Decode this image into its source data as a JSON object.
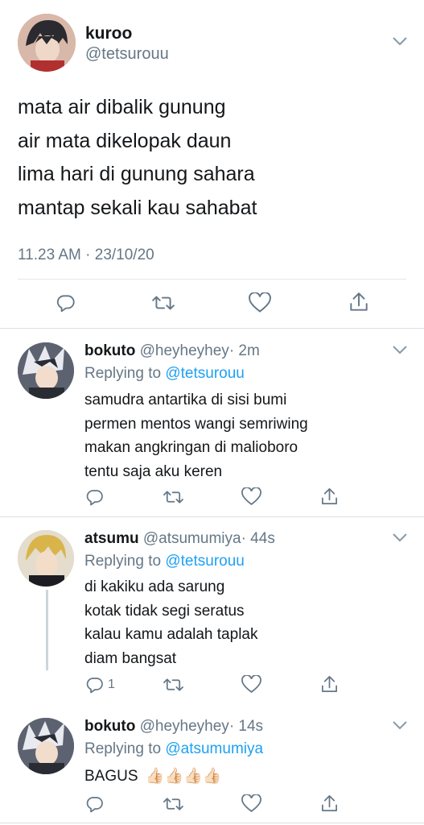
{
  "main_tweet": {
    "author_name": "kuroo",
    "author_handle": "@tetsurouu",
    "lines": [
      "mata air dibalik gunung",
      "air mata dikelopak daun",
      "lima hari di gunung sahara",
      "mantap sekali kau sahabat"
    ],
    "timestamp": "11.23 AM · 23/10/20"
  },
  "replies": [
    {
      "author_name": "bokuto",
      "author_handle": "@heyheyhey",
      "age": "· 2m",
      "replying_label": "Replying to",
      "replying_to": "@tetsurouu",
      "lines": [
        "samudra antartika di sisi bumi",
        "permen mentos wangi semriwing",
        "makan angkringan di malioboro",
        "tentu saja aku keren"
      ],
      "reply_count": ""
    },
    {
      "author_name": "atsumu",
      "author_handle": "@atsumumiya",
      "age": "· 44s",
      "replying_label": "Replying to",
      "replying_to": "@tetsurouu",
      "lines": [
        "di kakiku ada sarung",
        "kotak tidak segi seratus",
        "kalau kamu adalah taplak",
        "diam bangsat"
      ],
      "reply_count": "1"
    },
    {
      "author_name": "bokuto",
      "author_handle": "@heyheyhey",
      "age": "· 14s",
      "replying_label": "Replying to",
      "replying_to": "@atsumumiya",
      "text": "BAGUS",
      "emoji": "👍🏻👍🏻👍🏻👍🏻",
      "reply_count": ""
    }
  ],
  "icons": {
    "reply": "reply-icon",
    "retweet": "retweet-icon",
    "like": "heart-icon",
    "share": "share-icon",
    "more": "chevron-down-icon"
  },
  "colors": {
    "accent": "#1da1f2",
    "muted": "#657786",
    "divider": "#e1e8ed"
  }
}
